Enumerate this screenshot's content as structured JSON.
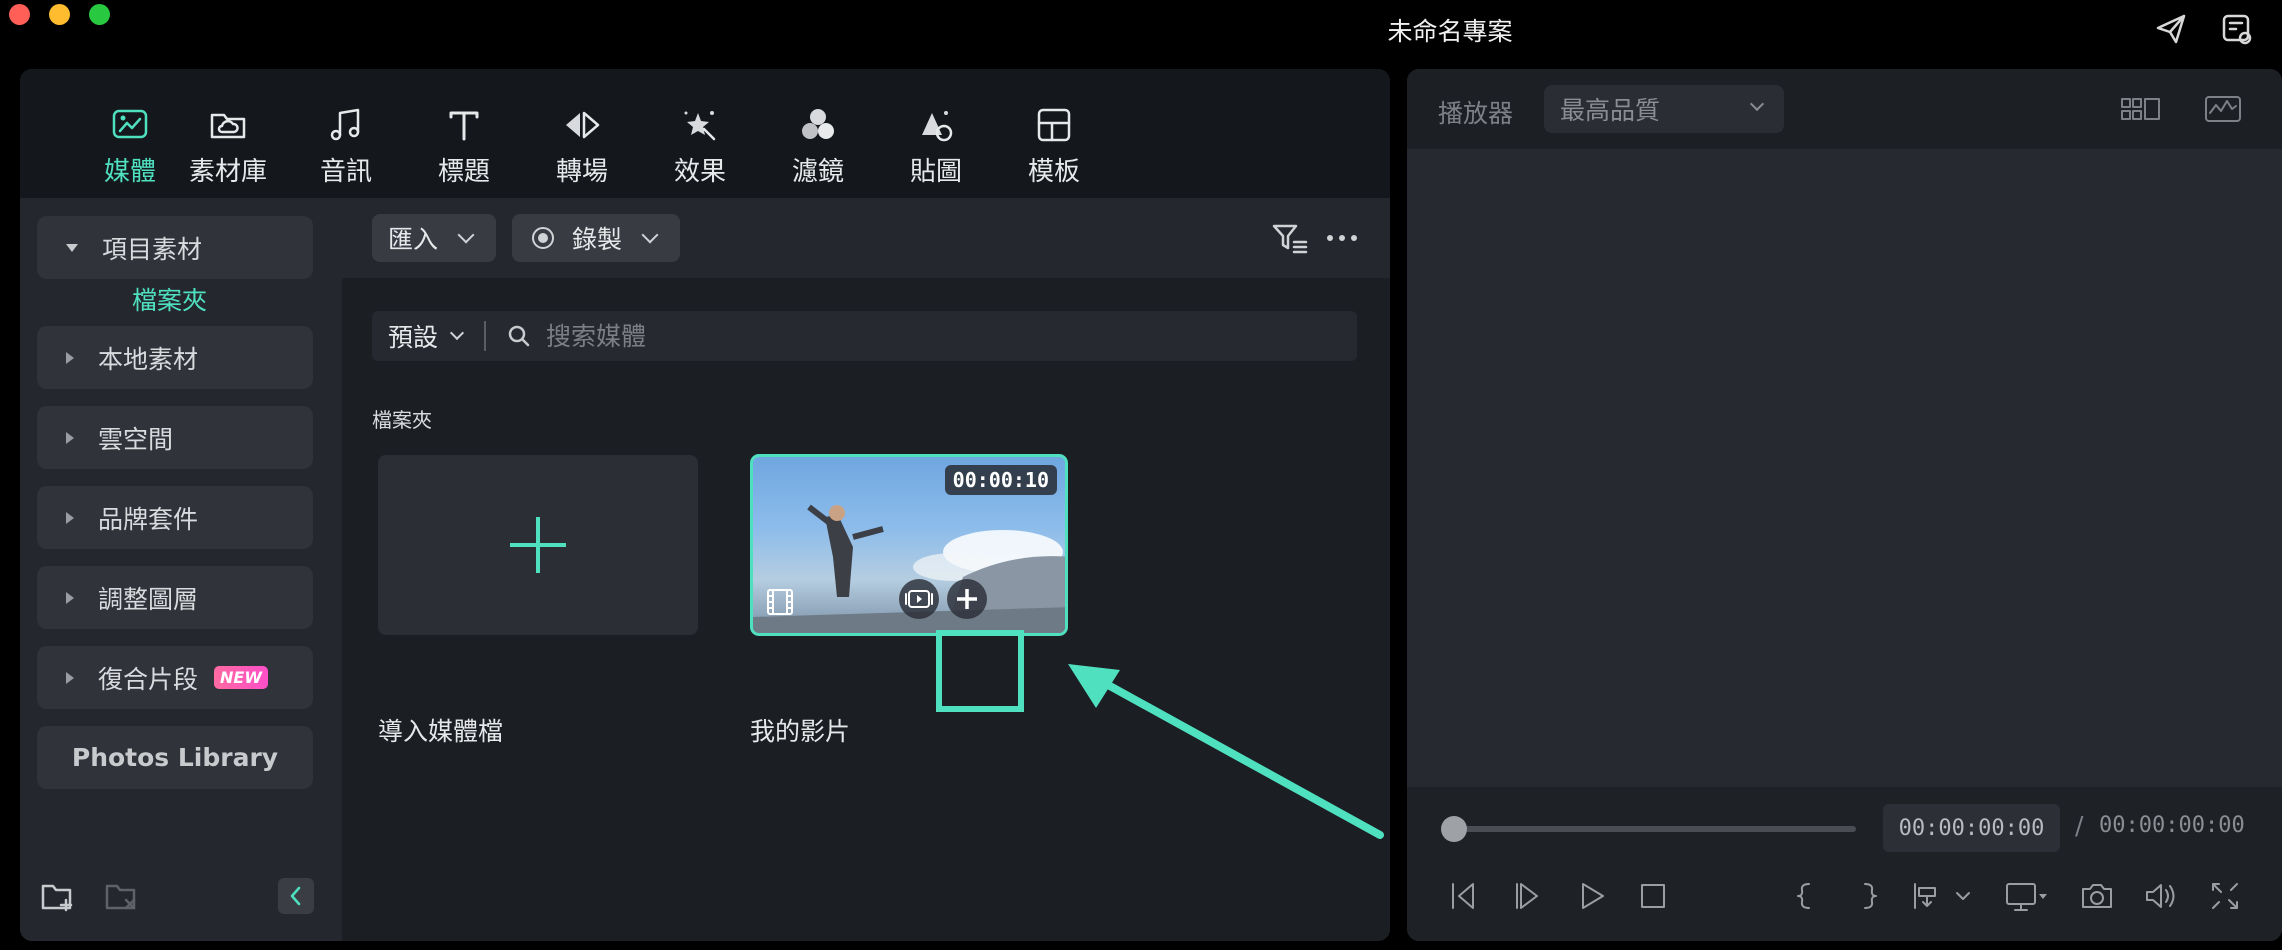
{
  "window": {
    "title": "未命名專案"
  },
  "toolbar": {
    "tabs": [
      {
        "label": "媒體",
        "icon": "media-icon",
        "active": true
      },
      {
        "label": "素材庫",
        "icon": "cloud-folder-icon"
      },
      {
        "label": "音訊",
        "icon": "music-note-icon"
      },
      {
        "label": "標題",
        "icon": "title-t-icon"
      },
      {
        "label": "轉場",
        "icon": "transition-icon"
      },
      {
        "label": "效果",
        "icon": "effects-star-icon"
      },
      {
        "label": "濾鏡",
        "icon": "filter-circles-icon"
      },
      {
        "label": "貼圖",
        "icon": "sticker-icon"
      },
      {
        "label": "模板",
        "icon": "template-icon"
      }
    ]
  },
  "sidebar": {
    "items": [
      {
        "label": "項目素材",
        "expanded": true
      },
      {
        "label": "本地素材"
      },
      {
        "label": "雲空間"
      },
      {
        "label": "品牌套件"
      },
      {
        "label": "調整圖層"
      },
      {
        "label": "復合片段",
        "badge": "NEW"
      },
      {
        "label": "Photos Library"
      }
    ],
    "sub_item": "檔案夾"
  },
  "content": {
    "import_label": "匯入",
    "record_label": "錄製",
    "sort_label": "預設",
    "search_placeholder": "搜索媒體",
    "section_label": "檔案夾",
    "import_tile_caption": "導入媒體檔",
    "video_caption": "我的影片",
    "video_duration": "00:00:10"
  },
  "player": {
    "label": "播放器",
    "quality": "最高品質",
    "current_time": "00:00:00:00",
    "separator": "/",
    "total_time": "00:00:00:00"
  },
  "colors": {
    "accent": "#4fe0c0",
    "panel": "#21242a",
    "toolbar": "#14171c"
  }
}
